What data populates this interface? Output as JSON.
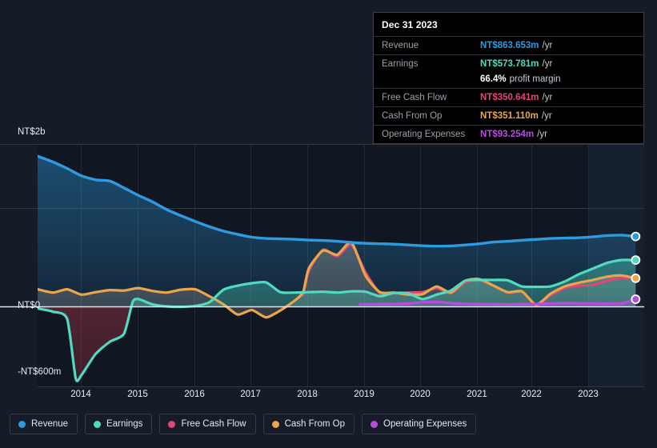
{
  "tooltip": {
    "date": "Dec 31 2023",
    "rows": [
      {
        "label": "Revenue",
        "value": "NT$863.653m",
        "unit": "/yr",
        "color": "#2e9ae0"
      },
      {
        "label": "Earnings",
        "value": "NT$573.781m",
        "unit": "/yr",
        "color": "#4fdbc0"
      },
      {
        "label": "",
        "value": "66.4%",
        "unit": "profit margin",
        "color": "#ffffff"
      },
      {
        "label": "Free Cash Flow",
        "value": "NT$350.641m",
        "unit": "/yr",
        "color": "#e0457b"
      },
      {
        "label": "Cash From Op",
        "value": "NT$351.110m",
        "unit": "/yr",
        "color": "#eaa githubusercontent"
      },
      {
        "label": "Operating Expenses",
        "value": "NT$93.254m",
        "unit": "/yr",
        "color": "#b94ce0"
      }
    ]
  },
  "axis": {
    "y_labels": [
      "NT$2b",
      "NT$0",
      "-NT$600m"
    ],
    "x_labels": [
      "2014",
      "2015",
      "2016",
      "2017",
      "2018",
      "2019",
      "2020",
      "2021",
      "2022",
      "2023"
    ]
  },
  "legend": {
    "items": [
      {
        "label": "Revenue",
        "color": "#2e9ae0"
      },
      {
        "label": "Earnings",
        "color": "#4fdbc0"
      },
      {
        "label": "Free Cash Flow",
        "color": "#e0457b"
      },
      {
        "label": "Cash From Op",
        "color": "#eaa74a"
      },
      {
        "label": "Operating Expenses",
        "color": "#b94ce0"
      }
    ]
  },
  "chart_data": {
    "type": "area",
    "title": "",
    "xlabel": "",
    "ylabel": "NT$",
    "ylim": [
      -600000000,
      2000000000
    ],
    "xlim": [
      2013.3,
      2024.0
    ],
    "grid": true,
    "legend_position": "bottom-left",
    "y_ticks": [
      {
        "label": "NT$2b",
        "value": 2000000000
      },
      {
        "label": "NT$0",
        "value": 0
      },
      {
        "label": "-NT$600m",
        "value": -600000000
      }
    ],
    "x_ticks": [
      2014,
      2015,
      2016,
      2017,
      2018,
      2019,
      2020,
      2021,
      2022,
      2023
    ],
    "forecast_band_start": 2023.0,
    "series": [
      {
        "name": "Revenue",
        "color": "#2e9ae0",
        "x": [
          2013.33,
          2013.6,
          2013.85,
          2014.1,
          2014.35,
          2014.6,
          2014.85,
          2015.1,
          2015.35,
          2015.6,
          2015.85,
          2016.1,
          2016.35,
          2016.6,
          2016.85,
          2017.1,
          2017.35,
          2017.6,
          2017.85,
          2018.1,
          2018.35,
          2018.6,
          2018.85,
          2019.1,
          2019.35,
          2019.6,
          2019.85,
          2020.1,
          2020.35,
          2020.6,
          2020.85,
          2021.1,
          2021.35,
          2021.6,
          2021.85,
          2022.1,
          2022.35,
          2022.6,
          2022.85,
          2023.1,
          2023.35,
          2023.6,
          2023.85
        ],
        "values": [
          1850,
          1780,
          1700,
          1610,
          1560,
          1545,
          1460,
          1370,
          1290,
          1195,
          1120,
          1050,
          985,
          930,
          890,
          855,
          840,
          835,
          830,
          820,
          815,
          805,
          790,
          780,
          775,
          770,
          760,
          750,
          745,
          748,
          760,
          775,
          795,
          805,
          818,
          828,
          840,
          845,
          848,
          860,
          875,
          880,
          864
        ],
        "unit": "NT$m"
      },
      {
        "name": "Earnings",
        "color": "#4fdbc0",
        "x": [
          2013.33,
          2013.6,
          2013.85,
          2014.0,
          2014.1,
          2014.35,
          2014.6,
          2014.85,
          2015.0,
          2015.1,
          2015.35,
          2015.6,
          2015.85,
          2016.1,
          2016.35,
          2016.6,
          2016.85,
          2017.1,
          2017.35,
          2017.6,
          2017.85,
          2018.1,
          2018.35,
          2018.6,
          2018.85,
          2019.1,
          2019.35,
          2019.6,
          2019.85,
          2020.1,
          2020.35,
          2020.6,
          2020.85,
          2021.1,
          2021.35,
          2021.6,
          2021.85,
          2022.1,
          2022.35,
          2022.6,
          2022.85,
          2023.1,
          2023.35,
          2023.6,
          2023.85
        ],
        "values": [
          -20,
          -60,
          -150,
          -880,
          -840,
          -580,
          -430,
          -330,
          55,
          95,
          30,
          5,
          0,
          10,
          55,
          210,
          260,
          290,
          300,
          180,
          175,
          180,
          185,
          175,
          190,
          185,
          130,
          170,
          165,
          95,
          150,
          200,
          320,
          330,
          330,
          325,
          250,
          245,
          250,
          310,
          400,
          470,
          540,
          575,
          574
        ],
        "unit": "NT$m"
      },
      {
        "name": "Free Cash Flow",
        "color": "#e0457b",
        "x": [
          2018.0,
          2018.1,
          2018.35,
          2018.6,
          2018.85,
          2019.1,
          2019.35,
          2019.6,
          2019.85,
          2020.1,
          2020.35,
          2020.6,
          2020.85,
          2021.1,
          2021.35,
          2021.6,
          2021.85,
          2022.1,
          2022.35,
          2022.6,
          2022.85,
          2023.1,
          2023.35,
          2023.6,
          2023.85
        ],
        "values": [
          140,
          440,
          700,
          620,
          760,
          420,
          170,
          165,
          175,
          180,
          230,
          165,
          300,
          330,
          260,
          175,
          185,
          20,
          140,
          230,
          260,
          270,
          320,
          355,
          351
        ],
        "unit": "NT$m"
      },
      {
        "name": "Cash From Op",
        "color": "#eaa74a",
        "x": [
          2013.33,
          2013.6,
          2013.85,
          2014.1,
          2014.35,
          2014.6,
          2014.85,
          2015.1,
          2015.35,
          2015.6,
          2015.85,
          2016.1,
          2016.35,
          2016.6,
          2016.85,
          2017.1,
          2017.35,
          2017.6,
          2017.85,
          2018.0,
          2018.1,
          2018.35,
          2018.6,
          2018.85,
          2019.1,
          2019.35,
          2019.6,
          2019.85,
          2020.1,
          2020.35,
          2020.6,
          2020.85,
          2021.1,
          2021.35,
          2021.6,
          2021.85,
          2022.1,
          2022.35,
          2022.6,
          2022.85,
          2023.1,
          2023.35,
          2023.6,
          2023.85
        ],
        "values": [
          215,
          175,
          215,
          150,
          180,
          205,
          200,
          230,
          195,
          175,
          210,
          215,
          130,
          30,
          -95,
          -40,
          -130,
          -45,
          75,
          180,
          470,
          690,
          640,
          790,
          380,
          180,
          175,
          150,
          155,
          250,
          175,
          320,
          340,
          260,
          180,
          190,
          25,
          160,
          250,
          295,
          330,
          370,
          385,
          351
        ],
        "unit": "NT$m"
      },
      {
        "name": "Operating Expenses",
        "color": "#b94ce0",
        "x": [
          2019.0,
          2019.35,
          2019.6,
          2019.85,
          2020.1,
          2020.35,
          2020.6,
          2020.85,
          2021.1,
          2021.35,
          2021.6,
          2021.85,
          2022.1,
          2022.35,
          2022.6,
          2022.85,
          2023.1,
          2023.35,
          2023.6,
          2023.85
        ],
        "values": [
          32,
          33,
          34,
          40,
          55,
          60,
          45,
          35,
          33,
          32,
          30,
          32,
          34,
          40,
          45,
          42,
          40,
          38,
          40,
          93
        ],
        "unit": "NT$m"
      }
    ]
  }
}
